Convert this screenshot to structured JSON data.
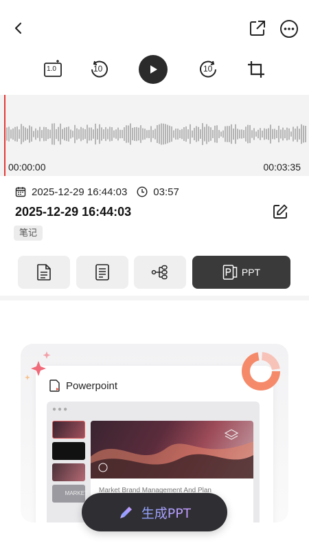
{
  "player": {
    "speed_label": "1.0",
    "rewind_seconds": "10",
    "forward_seconds": "10"
  },
  "waveform": {
    "time_start": "00:00:00",
    "time_end": "00:03:35",
    "playhead_color": "#e53935"
  },
  "recording": {
    "date": "2025-12-29 16:44:03",
    "duration": "03:57",
    "title": "2025-12-29 16:44:03",
    "tag": "笔记"
  },
  "tabs": [
    {
      "name": "document",
      "icon": "document-icon",
      "selected": false
    },
    {
      "name": "summary",
      "icon": "text-list-icon",
      "selected": false
    },
    {
      "name": "mindmap",
      "icon": "mindmap-icon",
      "selected": false
    },
    {
      "name": "ppt",
      "icon": "ppt-icon",
      "label": "PPT",
      "selected": true
    }
  ],
  "preview": {
    "app_title": "Powerpoint",
    "slide_caption": "Market Brand Management And Plan",
    "thumb_caption": "MARKET"
  },
  "generate_button": {
    "label": "生成PPT"
  },
  "colors": {
    "dark_button": "#2f2f33",
    "selected_tab": "#3a3a3a",
    "tab_bg": "#efefef",
    "accent_gradient_start": "#8fa6ff",
    "accent_gradient_end": "#c79bff"
  }
}
